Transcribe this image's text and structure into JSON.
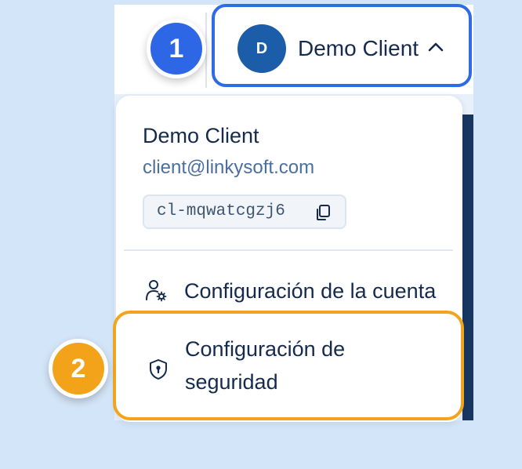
{
  "header": {
    "avatar_initial": "D",
    "user_name": "Demo Client"
  },
  "dropdown": {
    "title": "Demo Client",
    "email": "client@linkysoft.com",
    "client_id": "cl-mqwatcgzj6",
    "items": [
      {
        "label": "Configuración de la cuenta",
        "icon": "user-settings-icon"
      },
      {
        "label": "Configuración de seguridad",
        "icon": "shield-lock-icon"
      }
    ]
  },
  "steps": {
    "one": "1",
    "two": "2"
  },
  "colors": {
    "background": "#d3e5f8",
    "primary_blue": "#2f6be6",
    "avatar_blue": "#1b5da8",
    "highlight_orange": "#f2a41e",
    "text_dark": "#152b4d",
    "text_link": "#4a6fa0"
  }
}
